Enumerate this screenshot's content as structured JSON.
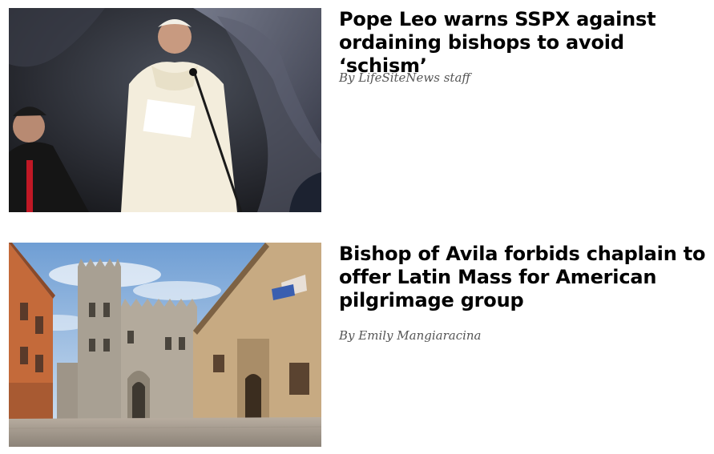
{
  "articles": [
    {
      "headline": "Pope Leo warns SSPX against ordaining bishops to avoid ‘schism’",
      "byline": "By LifeSiteNews staff",
      "image_subject": "pope-speaking-photo"
    },
    {
      "headline": "Bishop of Avila forbids chaplain to offer Latin Mass for American pilgrimage group",
      "byline": "By Emily Mangiaracina",
      "image_subject": "avila-cathedral-photo"
    }
  ],
  "colors": {
    "headline": "#000000",
    "byline": "#555555",
    "background": "#ffffff"
  }
}
